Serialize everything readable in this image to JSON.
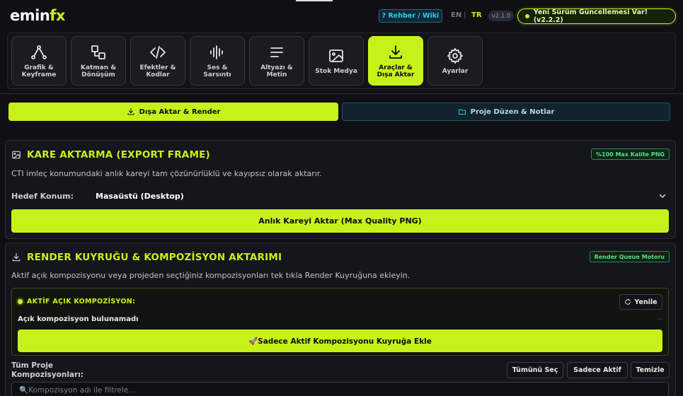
{
  "header": {
    "logo_main": "emin",
    "logo_accent": "fx",
    "wiki_label": "? Rehber / Wiki",
    "lang_en": "EN",
    "lang_sep": "|",
    "lang_tr": "TR",
    "version": "v2.1.0",
    "update_label": "Yeni Sürüm Güncellemesi Var! (v2.2.2)"
  },
  "tools": [
    {
      "label": "Grafik &\nKeyframe",
      "icon": "graph-icon"
    },
    {
      "label": "Katman &\nDönüşüm",
      "icon": "layers-icon"
    },
    {
      "label": "Efektler &\nKodlar",
      "icon": "code-icon"
    },
    {
      "label": "Ses &\nSarsıntı",
      "icon": "waveform-icon"
    },
    {
      "label": "Altyazı &\nMetin",
      "icon": "text-lines-icon"
    },
    {
      "label": "Stok Medya",
      "icon": "image-icon"
    },
    {
      "label": "Araçlar &\nDışa Aktar",
      "icon": "download-icon",
      "active": true
    },
    {
      "label": "Ayarlar",
      "icon": "gear-icon"
    }
  ],
  "subtabs": {
    "export": "Dışa Aktar & Render",
    "project": "Proje Düzen & Notlar"
  },
  "export_frame": {
    "title": "KARE AKTARMA (EXPORT FRAME)",
    "badge": "%100 Max Kalite PNG",
    "description": "CTI imleç konumundaki anlık kareyi tam çözünürlüklü ve kayıpsız olarak aktarır.",
    "target_label": "Hedef Konum:",
    "target_value": "Masaüstü (Desktop)",
    "button": "Anlık Kareyi Aktar (Max Quality PNG)"
  },
  "render_queue": {
    "title": "RENDER KUYRUĞU & KOMPOZİSYON AKTARIMI",
    "badge": "Render Queue Motoru",
    "description": "Aktif açık kompozisyonu veya projeden seçtiğiniz kompozisyonları tek tıkla Render Kuyruğuna ekleyin.",
    "active_title": "AKTİF AÇIK KOMPOZİSYON:",
    "refresh": "Yenile",
    "status": "Açık kompozisyon bulunamadı",
    "status_dash": "--",
    "add_button": "🚀Sadece Aktif Kompozisyonu Kuyruğa Ekle",
    "all_label": "Tüm Proje\nKompozisyonları:",
    "select_all": "Tümünü Seç",
    "only_active": "Sadece Aktif",
    "clear": "Temizle",
    "filter_placeholder": "🔍Kompozisyon adı ile filtrele..."
  },
  "colors": {
    "accent": "#c6f21a",
    "background": "#101014",
    "info": "#38c6ef",
    "badge_green": "#56e08a"
  }
}
